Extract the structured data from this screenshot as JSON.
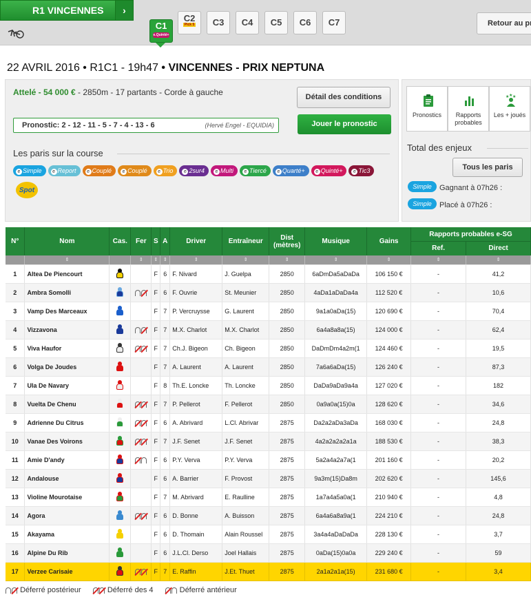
{
  "header": {
    "reunion_label": "R1  VINCENNES",
    "arrow": "›",
    "courses": [
      {
        "label": "C1",
        "badge": "e.Quinté+"
      },
      {
        "label": "C2",
        "badge": "Pick 5"
      },
      {
        "label": "C3"
      },
      {
        "label": "C4"
      },
      {
        "label": "C5"
      },
      {
        "label": "C6"
      },
      {
        "label": "C7"
      }
    ],
    "retour_label": "Retour au pro"
  },
  "race": {
    "date": "22 AVRIL 2016 • R1C1 - 19h47",
    "name": " • VINCENNES - PRIX NEPTUNA",
    "discipline": "Attelé - 54 000 €",
    "details": " - 2850m - 17 partants  - Corde à gauche",
    "conditions_label": "Détail des conditions",
    "pronostic": "Pronostic: 2 - 12 - 11 - 5 - 7 - 4 - 13 - 6",
    "pronostic_source": "(Hervé Engel - EQUIDIA)",
    "jouer_label": "Jouer le pronostic",
    "paris_title": "Les paris sur la course",
    "bets": [
      {
        "label": "Simple",
        "color": "#1aa4e0"
      },
      {
        "label": "Report",
        "color": "#67c0d6"
      },
      {
        "label": "Couplé",
        "color": "#e07b19"
      },
      {
        "label": "Couplé",
        "color": "#e08a1a"
      },
      {
        "label": "Trio",
        "color": "#f0a020"
      },
      {
        "label": "2sur4",
        "color": "#6a2e91"
      },
      {
        "label": "Multi",
        "color": "#c2187b"
      },
      {
        "label": "Tiercé",
        "color": "#2ca64a"
      },
      {
        "label": "Quarté+",
        "color": "#3d7fc9"
      },
      {
        "label": "Quinté+",
        "color": "#d2185c"
      },
      {
        "label": "Tic3",
        "color": "#8a1638"
      }
    ],
    "spot_label": "Spot"
  },
  "side": {
    "tiles": [
      "Pronostics",
      "Rapports probables",
      "Les + joués"
    ],
    "total_title": "Total des enjeux",
    "tous_label": "Tous les paris",
    "simple_badge": "Simple",
    "gagnant": "Gagnant à 07h26 :",
    "place": "Placé à 07h26 :"
  },
  "table": {
    "headers": {
      "num": "N°",
      "nom": "Nom",
      "cas": "Cas.",
      "fer": "Fer",
      "s": "S",
      "a": "A",
      "driver": "Driver",
      "entraineur": "Entraîneur",
      "dist": "Dist (mètres)",
      "musique": "Musique",
      "gains": "Gains",
      "rapports": "Rapports probables e-SG",
      "ref": "Ref.",
      "direct": "Direct"
    },
    "sort_glyph": "⇕",
    "rows": [
      {
        "num": "1",
        "nom": "Altea De Piencourt",
        "fer": "",
        "s": "F",
        "a": "6",
        "driver": "F. Nivard",
        "entraineur": "J. Guelpa",
        "dist": "2850",
        "musique": "6aDmDa5aDaDa",
        "gains": "106 150 €",
        "ref": "-",
        "direct": "41,2",
        "jockey": [
          "#f5d000",
          "#111"
        ]
      },
      {
        "num": "2",
        "nom": "Ambra Somolli",
        "fer": "DP",
        "s": "F",
        "a": "6",
        "driver": "F. Ouvrie",
        "entraineur": "St. Meunier",
        "dist": "2850",
        "musique": "4aDa1aDaDa4a",
        "gains": "112 520 €",
        "ref": "-",
        "direct": "10,6",
        "jockey": [
          "#1a3a9a",
          "#6aa8e0"
        ]
      },
      {
        "num": "3",
        "nom": "Vamp Des Marceaux",
        "fer": "",
        "s": "F",
        "a": "7",
        "driver": "P. Vercruysse",
        "entraineur": "G. Laurent",
        "dist": "2850",
        "musique": "9a1a0aDa(15)",
        "gains": "120 690 €",
        "ref": "-",
        "direct": "70,4",
        "jockey": [
          "#1a5fcc",
          "#1a5fcc"
        ]
      },
      {
        "num": "4",
        "nom": "Vizzavona",
        "fer": "DP",
        "s": "F",
        "a": "7",
        "driver": "M.X. Charlot",
        "entraineur": "M.X. Charlot",
        "dist": "2850",
        "musique": "6a4a8a8a(15)",
        "gains": "124 000 €",
        "ref": "-",
        "direct": "62,4",
        "jockey": [
          "#1a3a9a",
          "#1a3a9a"
        ]
      },
      {
        "num": "5",
        "nom": "Viva Haufor",
        "fer": "D4",
        "s": "F",
        "a": "7",
        "driver": "Ch.J. Bigeon",
        "entraineur": "Ch. Bigeon",
        "dist": "2850",
        "musique": "DaDmDm4a2m(1",
        "gains": "124 460 €",
        "ref": "-",
        "direct": "19,5",
        "jockey": [
          "#eeeeee",
          "#333"
        ]
      },
      {
        "num": "6",
        "nom": "Volga De Joudes",
        "fer": "",
        "s": "F",
        "a": "7",
        "driver": "A. Laurent",
        "entraineur": "A. Laurent",
        "dist": "2850",
        "musique": "7a6a6aDa(15)",
        "gains": "126 240 €",
        "ref": "-",
        "direct": "87,3",
        "jockey": [
          "#d11",
          "#d11"
        ]
      },
      {
        "num": "7",
        "nom": "Ula De Navary",
        "fer": "",
        "s": "F",
        "a": "8",
        "driver": "Th.E. Loncke",
        "entraineur": "Th. Loncke",
        "dist": "2850",
        "musique": "DaDa9aDa9a4a",
        "gains": "127 020 €",
        "ref": "-",
        "direct": "182",
        "jockey": [
          "#eee",
          "#d11"
        ]
      },
      {
        "num": "8",
        "nom": "Vuelta De Chenu",
        "fer": "D4",
        "s": "F",
        "a": "7",
        "driver": "P. Pellerot",
        "entraineur": "F. Pellerot",
        "dist": "2850",
        "musique": "0a9a0a(15)0a",
        "gains": "128 620 €",
        "ref": "-",
        "direct": "34,6",
        "jockey": [
          "#d11",
          "#eee"
        ]
      },
      {
        "num": "9",
        "nom": "Adrienne Du Citrus",
        "fer": "D4",
        "s": "F",
        "a": "6",
        "driver": "A. Abrivard",
        "entraineur": "L.Cl. Abrivar",
        "dist": "2875",
        "musique": "Da2a2aDa3aDa",
        "gains": "168 030 €",
        "ref": "-",
        "direct": "24,8",
        "jockey": [
          "#2a9a3a",
          "#eee"
        ]
      },
      {
        "num": "10",
        "nom": "Vanae Des Voirons",
        "fer": "D4",
        "s": "F",
        "a": "7",
        "driver": "J.F. Senet",
        "entraineur": "J.F. Senet",
        "dist": "2875",
        "musique": "4a2a2a2a2a1a",
        "gains": "188 530 €",
        "ref": "-",
        "direct": "38,3",
        "jockey": [
          "#d11",
          "#2a9a3a"
        ]
      },
      {
        "num": "11",
        "nom": "Amie D'andy",
        "fer": "DA",
        "s": "F",
        "a": "6",
        "driver": "P.Y. Verva",
        "entraineur": "P.Y. Verva",
        "dist": "2875",
        "musique": "5a2a4a2a7a(1",
        "gains": "201 160 €",
        "ref": "-",
        "direct": "20,2",
        "jockey": [
          "#1a3a9a",
          "#d11"
        ]
      },
      {
        "num": "12",
        "nom": "Andalouse",
        "fer": "",
        "s": "F",
        "a": "6",
        "driver": "A. Barrier",
        "entraineur": "F. Provost",
        "dist": "2875",
        "musique": "9a3m(15)Da8m",
        "gains": "202 620 €",
        "ref": "-",
        "direct": "145,6",
        "jockey": [
          "#1a3a9a",
          "#d11"
        ]
      },
      {
        "num": "13",
        "nom": "Violine Mourotaise",
        "fer": "",
        "s": "F",
        "a": "7",
        "driver": "M. Abrivard",
        "entraineur": "E. Raulline",
        "dist": "2875",
        "musique": "1a7a4a5a0a(1",
        "gains": "210 940 €",
        "ref": "-",
        "direct": "4,8",
        "jockey": [
          "#2a9a3a",
          "#d11"
        ]
      },
      {
        "num": "14",
        "nom": "Agora",
        "fer": "D4",
        "s": "F",
        "a": "6",
        "driver": "D. Bonne",
        "entraineur": "A. Buisson",
        "dist": "2875",
        "musique": "6a4a6a8a9a(1",
        "gains": "224 210 €",
        "ref": "-",
        "direct": "24,8",
        "jockey": [
          "#3a8ad0",
          "#3a8ad0"
        ]
      },
      {
        "num": "15",
        "nom": "Akayama",
        "fer": "",
        "s": "F",
        "a": "6",
        "driver": "D. Thomain",
        "entraineur": "Alain Roussel",
        "dist": "2875",
        "musique": "3a4a4aDaDaDa",
        "gains": "228 130 €",
        "ref": "-",
        "direct": "3,7",
        "jockey": [
          "#f5d000",
          "#f5d000"
        ]
      },
      {
        "num": "16",
        "nom": "Alpine Du Rib",
        "fer": "",
        "s": "F",
        "a": "6",
        "driver": "J.L.Cl. Derso",
        "entraineur": "Joel Hallais",
        "dist": "2875",
        "musique": "0aDa(15)0a0a",
        "gains": "229 240 €",
        "ref": "-",
        "direct": "59",
        "jockey": [
          "#2a9a3a",
          "#2a9a3a"
        ]
      },
      {
        "num": "17",
        "nom": "Verzee Carisaie",
        "fer": "D4",
        "s": "F",
        "a": "7",
        "driver": "E. Raffin",
        "entraineur": "J.Et. Thuet",
        "dist": "2875",
        "musique": "2a1a2a1a(15)",
        "gains": "231 680 €",
        "ref": "-",
        "direct": "3,4",
        "jockey": [
          "#d11",
          "#333"
        ]
      }
    ]
  },
  "legend": {
    "dp": "Déferré postérieur",
    "d4": "Déferré des 4",
    "da": "Déferré antérieur"
  }
}
